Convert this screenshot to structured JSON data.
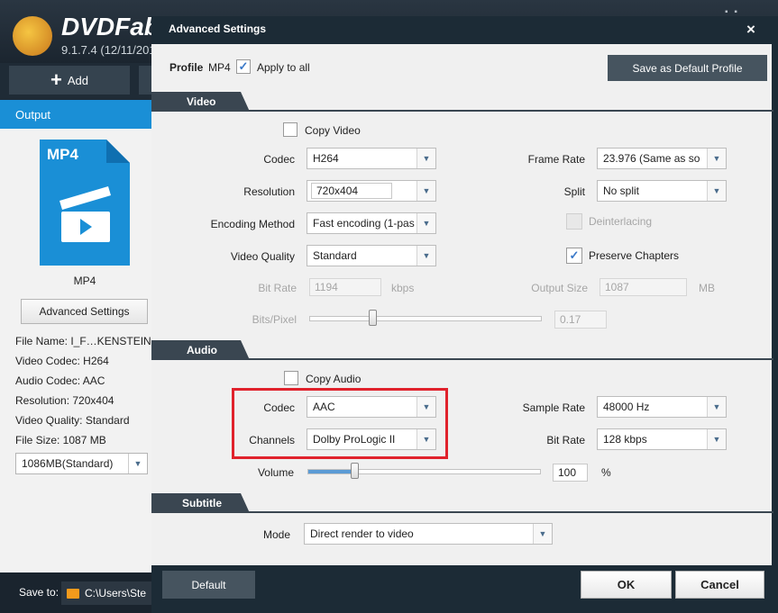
{
  "app": {
    "name": "DVDFab",
    "version": "9.1.7.4 (12/11/201",
    "add_label": "Add",
    "output_tab": "Output",
    "format_icon_label": "MP4",
    "format_caption": "MP4",
    "advanced_settings_label": "Advanced Settings",
    "file_info": {
      "file_name": "File Name: I_F…KENSTEIN",
      "video_codec": "Video Codec: H264",
      "audio_codec": "Audio Codec: AAC",
      "resolution": "Resolution: 720x404",
      "video_quality": "Video Quality: Standard",
      "file_size": "File Size: 1087 MB"
    },
    "size_select": "1086MB(Standard)",
    "save_to_label": "Save to:",
    "save_path": "C:\\Users\\Ste",
    "accent_color": "#1a8fd6"
  },
  "dialog": {
    "title": "Advanced Settings",
    "close": "×",
    "profile_label": "Profile",
    "profile_value": "MP4",
    "apply_all_label": "Apply to all",
    "apply_all_checked": true,
    "save_default_label": "Save as Default Profile",
    "video": {
      "section_label": "Video",
      "copy_video_label": "Copy Video",
      "codec_label": "Codec",
      "codec_value": "H264",
      "resolution_label": "Resolution",
      "resolution_value": "720x404",
      "encoding_label": "Encoding Method",
      "encoding_value": "Fast encoding (1-pas",
      "quality_label": "Video Quality",
      "quality_value": "Standard",
      "bitrate_label": "Bit Rate",
      "bitrate_value": "1194",
      "bitrate_unit": "kbps",
      "bits_pixel_label": "Bits/Pixel",
      "bits_pixel_value": "0.17",
      "bits_pixel_level": 0.27,
      "frame_rate_label": "Frame Rate",
      "frame_rate_value": "23.976 (Same as so",
      "split_label": "Split",
      "split_value": "No split",
      "deinterlacing_label": "Deinterlacing",
      "preserve_chapters_label": "Preserve Chapters",
      "preserve_chapters_checked": true,
      "output_size_label": "Output Size",
      "output_size_value": "1087",
      "output_size_unit": "MB"
    },
    "audio": {
      "section_label": "Audio",
      "copy_audio_label": "Copy Audio",
      "codec_label": "Codec",
      "codec_value": "AAC",
      "channels_label": "Channels",
      "channels_value": "Dolby ProLogic II",
      "volume_label": "Volume",
      "volume_value": "100",
      "volume_unit": "%",
      "volume_level": 0.2,
      "sample_rate_label": "Sample Rate",
      "sample_rate_value": "48000 Hz",
      "bitrate_label": "Bit Rate",
      "bitrate_value": "128 kbps"
    },
    "subtitle": {
      "section_label": "Subtitle",
      "mode_label": "Mode",
      "mode_value": "Direct render to video"
    },
    "default_label": "Default",
    "ok_label": "OK",
    "cancel_label": "Cancel",
    "highlight_color": "#e0222c"
  }
}
